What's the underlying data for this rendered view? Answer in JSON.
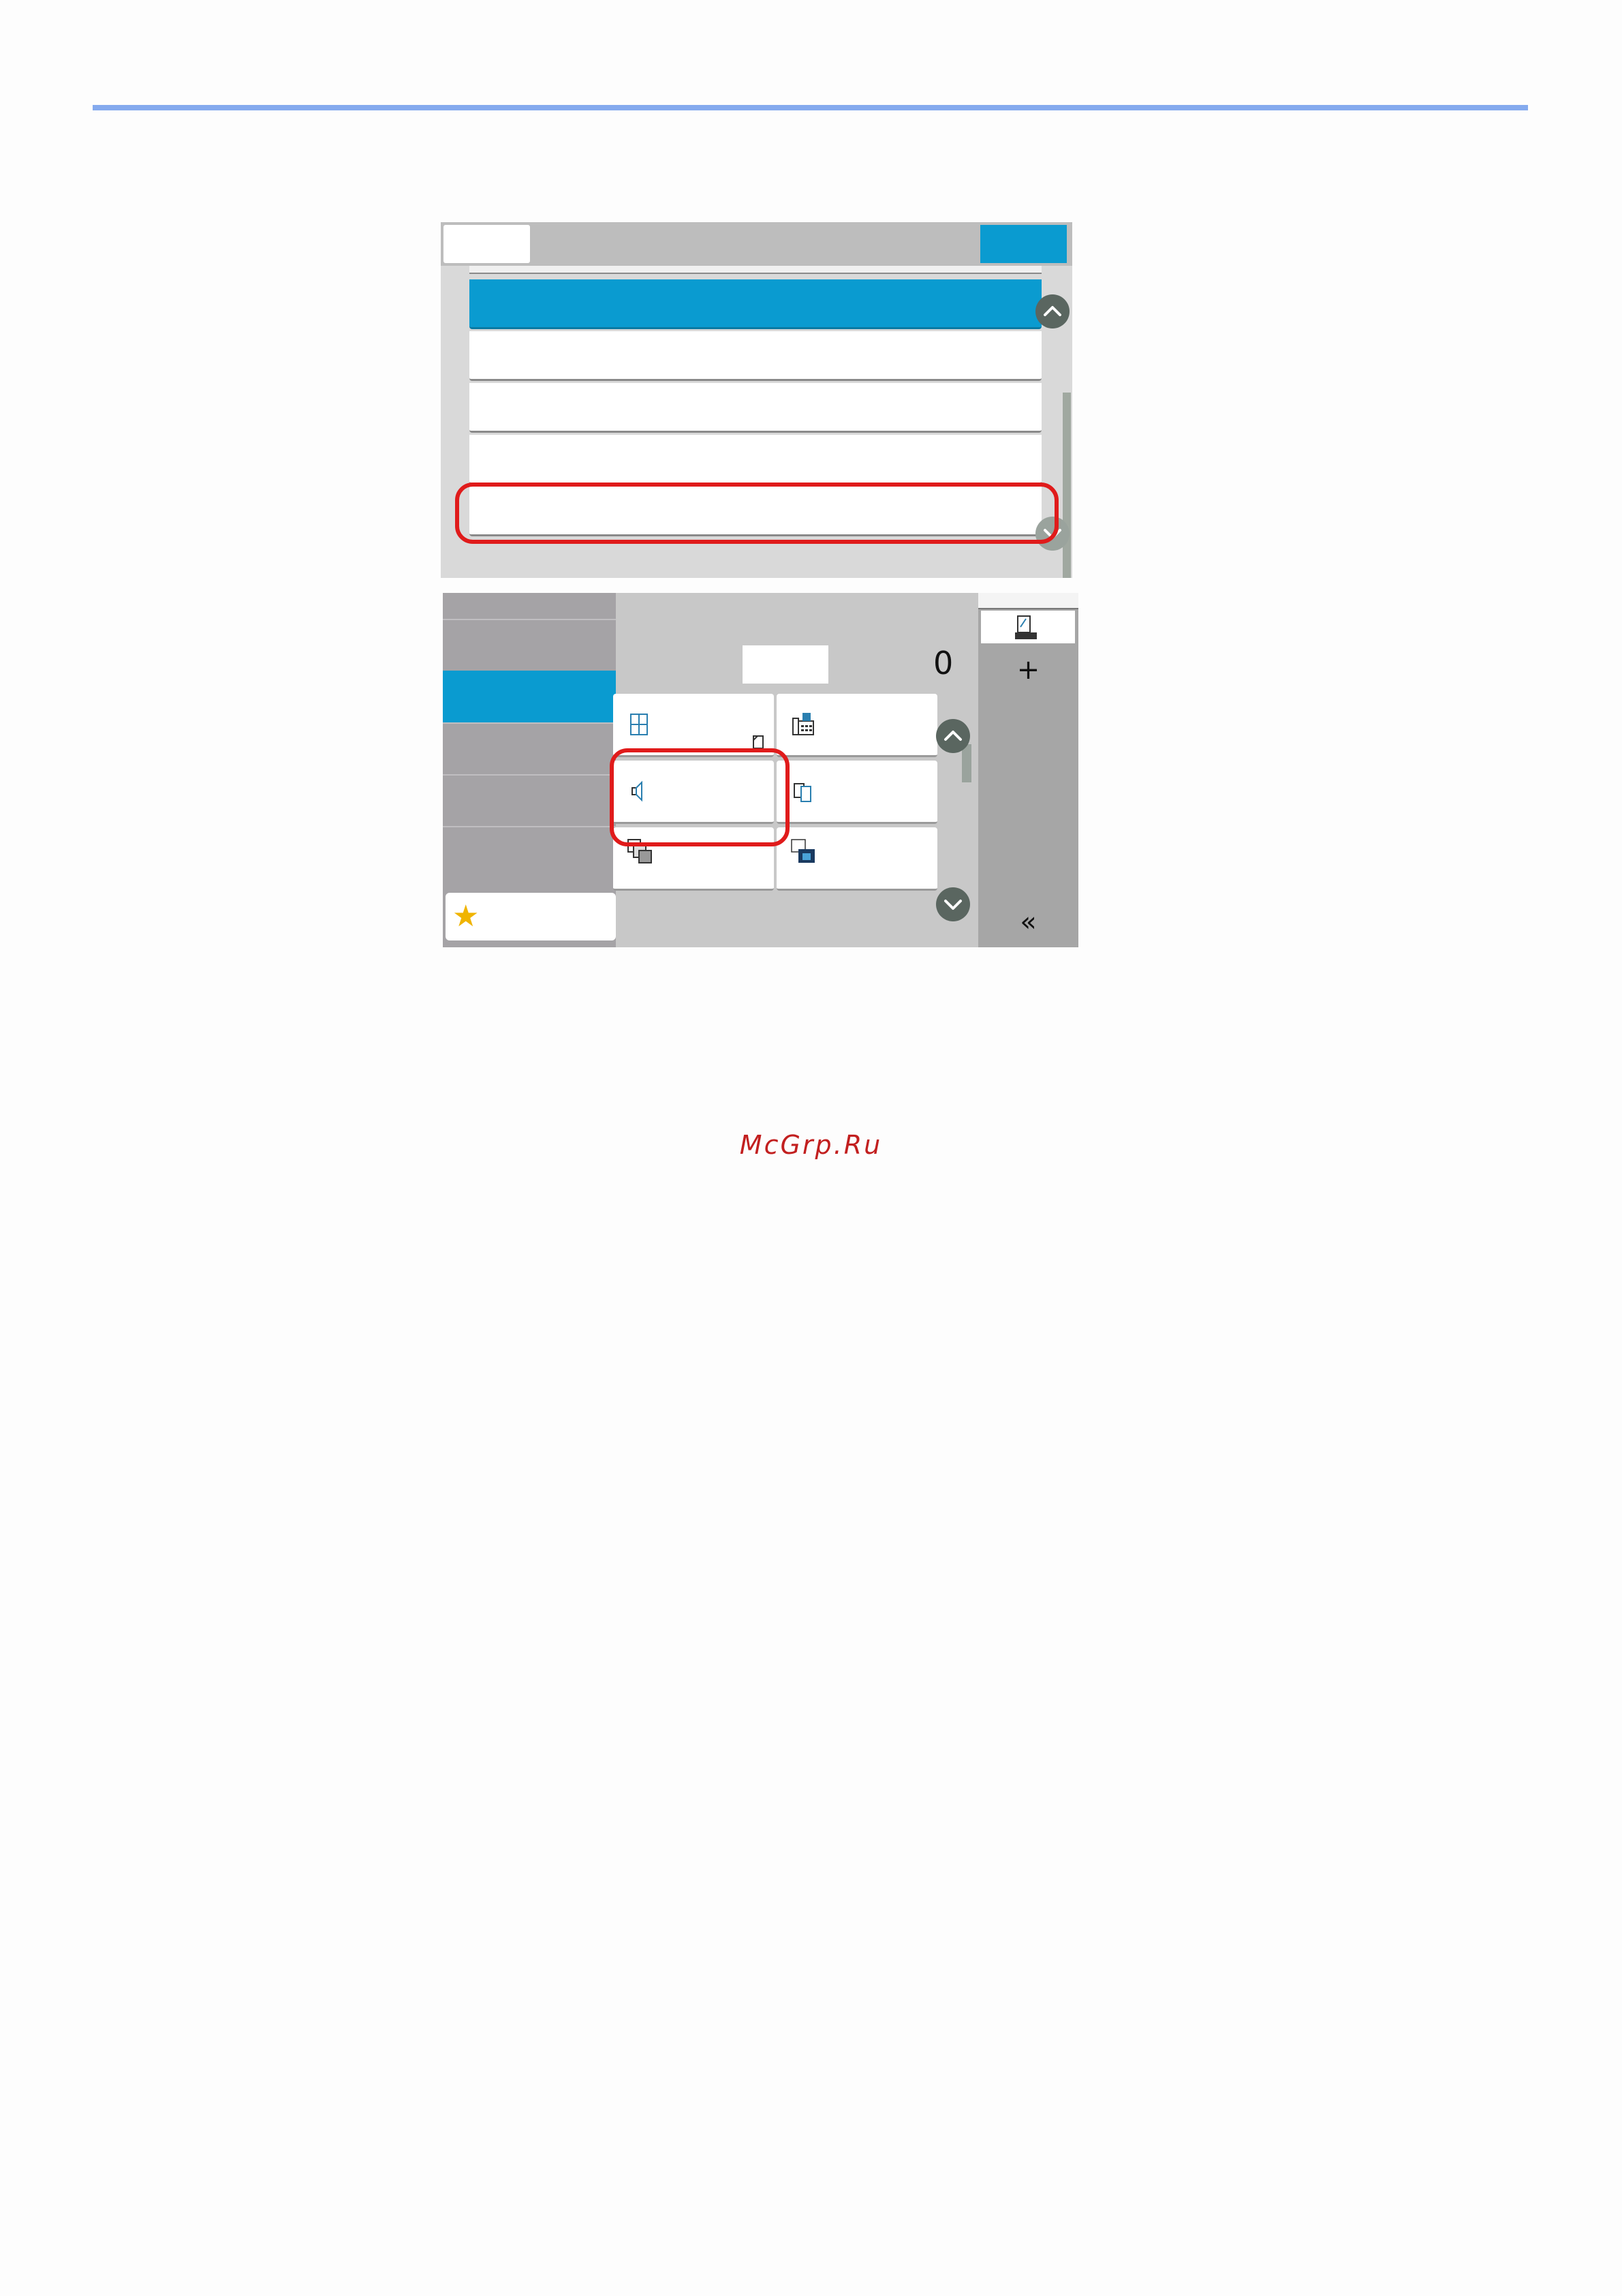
{
  "screen1": {
    "header": {
      "back_label": "",
      "ok_label": ""
    },
    "list_items": [
      {
        "label": "",
        "selected": true
      },
      {
        "label": "",
        "selected": false
      },
      {
        "label": "",
        "selected": false
      },
      {
        "label": "",
        "selected": false
      },
      {
        "label": "",
        "selected": false,
        "highlighted": true
      }
    ]
  },
  "screen2": {
    "sidebar_tabs": [
      {
        "label": "",
        "selected": false
      },
      {
        "label": "",
        "selected": true
      },
      {
        "label": "",
        "selected": false
      },
      {
        "label": "",
        "selected": false
      },
      {
        "label": "",
        "selected": false
      }
    ],
    "favorites_icon": "star-icon",
    "copies": "0",
    "function_keys": [
      {
        "icon": "original-size-icon",
        "label": ""
      },
      {
        "icon": "fax-icon",
        "label": ""
      },
      {
        "icon": "volume-icon",
        "label": "",
        "highlighted": true
      },
      {
        "icon": "duplex-icon",
        "label": ""
      },
      {
        "icon": "combine-icon",
        "label": ""
      },
      {
        "icon": "image-quality-icon",
        "label": ""
      }
    ],
    "right_panel": {
      "add_label": "+",
      "collapse_label": "«"
    }
  },
  "watermark": "McGrp.Ru",
  "colors": {
    "accent": "#0a9bd0",
    "highlight": "#e01b1b",
    "rule": "#85aaee"
  }
}
